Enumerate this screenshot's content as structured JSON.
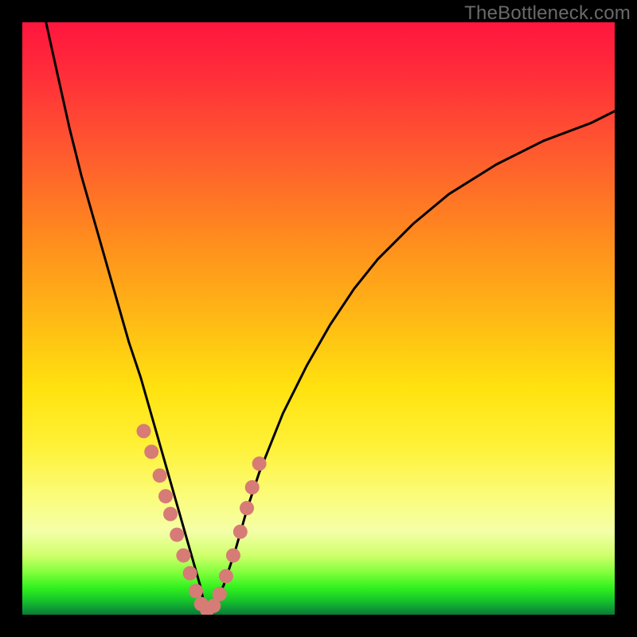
{
  "watermark": "TheBottleneck.com",
  "colors": {
    "background_frame": "#000000",
    "curve": "#000000",
    "marker_fill": "#d77b76",
    "marker_stroke": "#c45a55",
    "gradient_top": "#ff163e",
    "gradient_bottom": "#0b7a34"
  },
  "chart_data": {
    "type": "line",
    "title": "",
    "xlabel": "",
    "ylabel": "",
    "xlim": [
      0,
      100
    ],
    "ylim": [
      0,
      100
    ],
    "grid": false,
    "legend": false,
    "annotations": [],
    "note": "Background is a vertical rainbow gradient (red top → green bottom). Axes have no tick labels; values below are estimated from pixel positions on a 0–100 scale for both axes. The curve is a V-shaped bottleneck curve reaching ~0 near x≈31.",
    "series": [
      {
        "name": "bottleneck-curve",
        "x": [
          4,
          6,
          8,
          10,
          12,
          14,
          16,
          18,
          20,
          22,
          24,
          26,
          28,
          30,
          31,
          32,
          34,
          36,
          38,
          40,
          44,
          48,
          52,
          56,
          60,
          66,
          72,
          80,
          88,
          96,
          100
        ],
        "y": [
          100,
          91,
          82,
          74,
          67,
          60,
          53,
          46,
          40,
          33,
          26,
          19,
          12,
          5,
          0.5,
          1,
          5,
          11,
          18,
          24,
          34,
          42,
          49,
          55,
          60,
          66,
          71,
          76,
          80,
          83,
          85
        ]
      }
    ],
    "markers": {
      "name": "highlighted-points",
      "note": "salmon-colored circular markers clustered near the V bottom on both branches",
      "x": [
        20.5,
        21.8,
        23.2,
        24.2,
        25.0,
        26.1,
        27.2,
        28.3,
        29.3,
        30.2,
        31.2,
        32.3,
        33.3,
        34.4,
        35.6,
        36.8,
        37.9,
        38.8,
        40.0
      ],
      "y": [
        31.0,
        27.5,
        23.5,
        20.0,
        17.0,
        13.5,
        10.0,
        7.0,
        4.0,
        1.8,
        0.8,
        1.5,
        3.5,
        6.5,
        10.0,
        14.0,
        18.0,
        21.5,
        25.5
      ]
    }
  }
}
